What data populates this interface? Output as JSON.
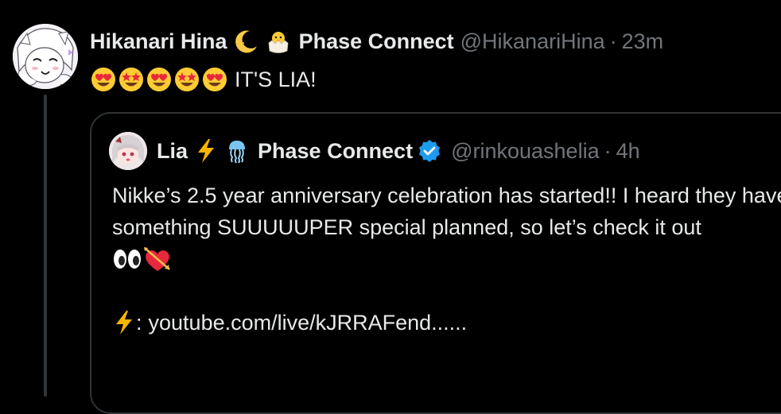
{
  "tweet": {
    "author_name": "Hikanari Hina",
    "author_affiliation": "Phase Connect",
    "handle": "@HikanariHina",
    "separator": "·",
    "time": "23m",
    "text": "IT'S LIA!",
    "name_emojis": [
      "crescent-moon-icon",
      "hatching-chick-icon"
    ],
    "text_emojis": [
      "heart-eyes-emoji",
      "star-struck-emoji",
      "heart-eyes-emoji",
      "star-struck-emoji",
      "heart-eyes-emoji"
    ]
  },
  "quote": {
    "author_name": "Lia",
    "author_affiliation": "Phase Connect",
    "handle": "@rinkouashelia",
    "separator": "·",
    "time": "4h",
    "verified": true,
    "name_emojis": [
      "lightning-icon",
      "jellyfish-icon"
    ],
    "line1": "Nikke’s 2.5 year anniversary celebration has started!! I heard they have",
    "line2": "something SUUUUUPER special planned, so let’s check it out",
    "line3_emojis": [
      "eyes-emoji",
      "heart-with-arrow-emoji"
    ],
    "link_prefix": ":",
    "link_text": "youtube.com/live/kJRRAFend......"
  },
  "colors": {
    "background": "#000000",
    "text": "#e7e9ea",
    "muted": "#71767b",
    "border": "#2f3336",
    "verified": "#1d9bf0"
  }
}
